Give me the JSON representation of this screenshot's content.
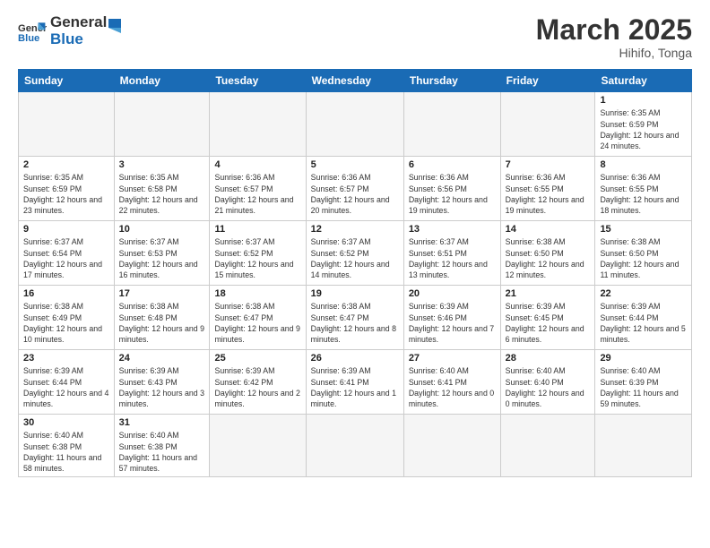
{
  "logo": {
    "text_general": "General",
    "text_blue": "Blue"
  },
  "title": "March 2025",
  "subtitle": "Hihifo, Tonga",
  "weekdays": [
    "Sunday",
    "Monday",
    "Tuesday",
    "Wednesday",
    "Thursday",
    "Friday",
    "Saturday"
  ],
  "weeks": [
    [
      {
        "day": "",
        "empty": true
      },
      {
        "day": "",
        "empty": true
      },
      {
        "day": "",
        "empty": true
      },
      {
        "day": "",
        "empty": true
      },
      {
        "day": "",
        "empty": true
      },
      {
        "day": "",
        "empty": true
      },
      {
        "day": "1",
        "info": "Sunrise: 6:35 AM\nSunset: 6:59 PM\nDaylight: 12 hours and 24 minutes."
      }
    ],
    [
      {
        "day": "2",
        "info": "Sunrise: 6:35 AM\nSunset: 6:59 PM\nDaylight: 12 hours and 23 minutes."
      },
      {
        "day": "3",
        "info": "Sunrise: 6:35 AM\nSunset: 6:58 PM\nDaylight: 12 hours and 22 minutes."
      },
      {
        "day": "4",
        "info": "Sunrise: 6:36 AM\nSunset: 6:57 PM\nDaylight: 12 hours and 21 minutes."
      },
      {
        "day": "5",
        "info": "Sunrise: 6:36 AM\nSunset: 6:57 PM\nDaylight: 12 hours and 20 minutes."
      },
      {
        "day": "6",
        "info": "Sunrise: 6:36 AM\nSunset: 6:56 PM\nDaylight: 12 hours and 19 minutes."
      },
      {
        "day": "7",
        "info": "Sunrise: 6:36 AM\nSunset: 6:55 PM\nDaylight: 12 hours and 19 minutes."
      },
      {
        "day": "8",
        "info": "Sunrise: 6:36 AM\nSunset: 6:55 PM\nDaylight: 12 hours and 18 minutes."
      }
    ],
    [
      {
        "day": "9",
        "info": "Sunrise: 6:37 AM\nSunset: 6:54 PM\nDaylight: 12 hours and 17 minutes."
      },
      {
        "day": "10",
        "info": "Sunrise: 6:37 AM\nSunset: 6:53 PM\nDaylight: 12 hours and 16 minutes."
      },
      {
        "day": "11",
        "info": "Sunrise: 6:37 AM\nSunset: 6:52 PM\nDaylight: 12 hours and 15 minutes."
      },
      {
        "day": "12",
        "info": "Sunrise: 6:37 AM\nSunset: 6:52 PM\nDaylight: 12 hours and 14 minutes."
      },
      {
        "day": "13",
        "info": "Sunrise: 6:37 AM\nSunset: 6:51 PM\nDaylight: 12 hours and 13 minutes."
      },
      {
        "day": "14",
        "info": "Sunrise: 6:38 AM\nSunset: 6:50 PM\nDaylight: 12 hours and 12 minutes."
      },
      {
        "day": "15",
        "info": "Sunrise: 6:38 AM\nSunset: 6:50 PM\nDaylight: 12 hours and 11 minutes."
      }
    ],
    [
      {
        "day": "16",
        "info": "Sunrise: 6:38 AM\nSunset: 6:49 PM\nDaylight: 12 hours and 10 minutes."
      },
      {
        "day": "17",
        "info": "Sunrise: 6:38 AM\nSunset: 6:48 PM\nDaylight: 12 hours and 9 minutes."
      },
      {
        "day": "18",
        "info": "Sunrise: 6:38 AM\nSunset: 6:47 PM\nDaylight: 12 hours and 9 minutes."
      },
      {
        "day": "19",
        "info": "Sunrise: 6:38 AM\nSunset: 6:47 PM\nDaylight: 12 hours and 8 minutes."
      },
      {
        "day": "20",
        "info": "Sunrise: 6:39 AM\nSunset: 6:46 PM\nDaylight: 12 hours and 7 minutes."
      },
      {
        "day": "21",
        "info": "Sunrise: 6:39 AM\nSunset: 6:45 PM\nDaylight: 12 hours and 6 minutes."
      },
      {
        "day": "22",
        "info": "Sunrise: 6:39 AM\nSunset: 6:44 PM\nDaylight: 12 hours and 5 minutes."
      }
    ],
    [
      {
        "day": "23",
        "info": "Sunrise: 6:39 AM\nSunset: 6:44 PM\nDaylight: 12 hours and 4 minutes."
      },
      {
        "day": "24",
        "info": "Sunrise: 6:39 AM\nSunset: 6:43 PM\nDaylight: 12 hours and 3 minutes."
      },
      {
        "day": "25",
        "info": "Sunrise: 6:39 AM\nSunset: 6:42 PM\nDaylight: 12 hours and 2 minutes."
      },
      {
        "day": "26",
        "info": "Sunrise: 6:39 AM\nSunset: 6:41 PM\nDaylight: 12 hours and 1 minute."
      },
      {
        "day": "27",
        "info": "Sunrise: 6:40 AM\nSunset: 6:41 PM\nDaylight: 12 hours and 0 minutes."
      },
      {
        "day": "28",
        "info": "Sunrise: 6:40 AM\nSunset: 6:40 PM\nDaylight: 12 hours and 0 minutes."
      },
      {
        "day": "29",
        "info": "Sunrise: 6:40 AM\nSunset: 6:39 PM\nDaylight: 11 hours and 59 minutes."
      }
    ],
    [
      {
        "day": "30",
        "info": "Sunrise: 6:40 AM\nSunset: 6:38 PM\nDaylight: 11 hours and 58 minutes."
      },
      {
        "day": "31",
        "info": "Sunrise: 6:40 AM\nSunset: 6:38 PM\nDaylight: 11 hours and 57 minutes."
      },
      {
        "day": "",
        "empty": true
      },
      {
        "day": "",
        "empty": true
      },
      {
        "day": "",
        "empty": true
      },
      {
        "day": "",
        "empty": true
      },
      {
        "day": "",
        "empty": true
      }
    ]
  ]
}
